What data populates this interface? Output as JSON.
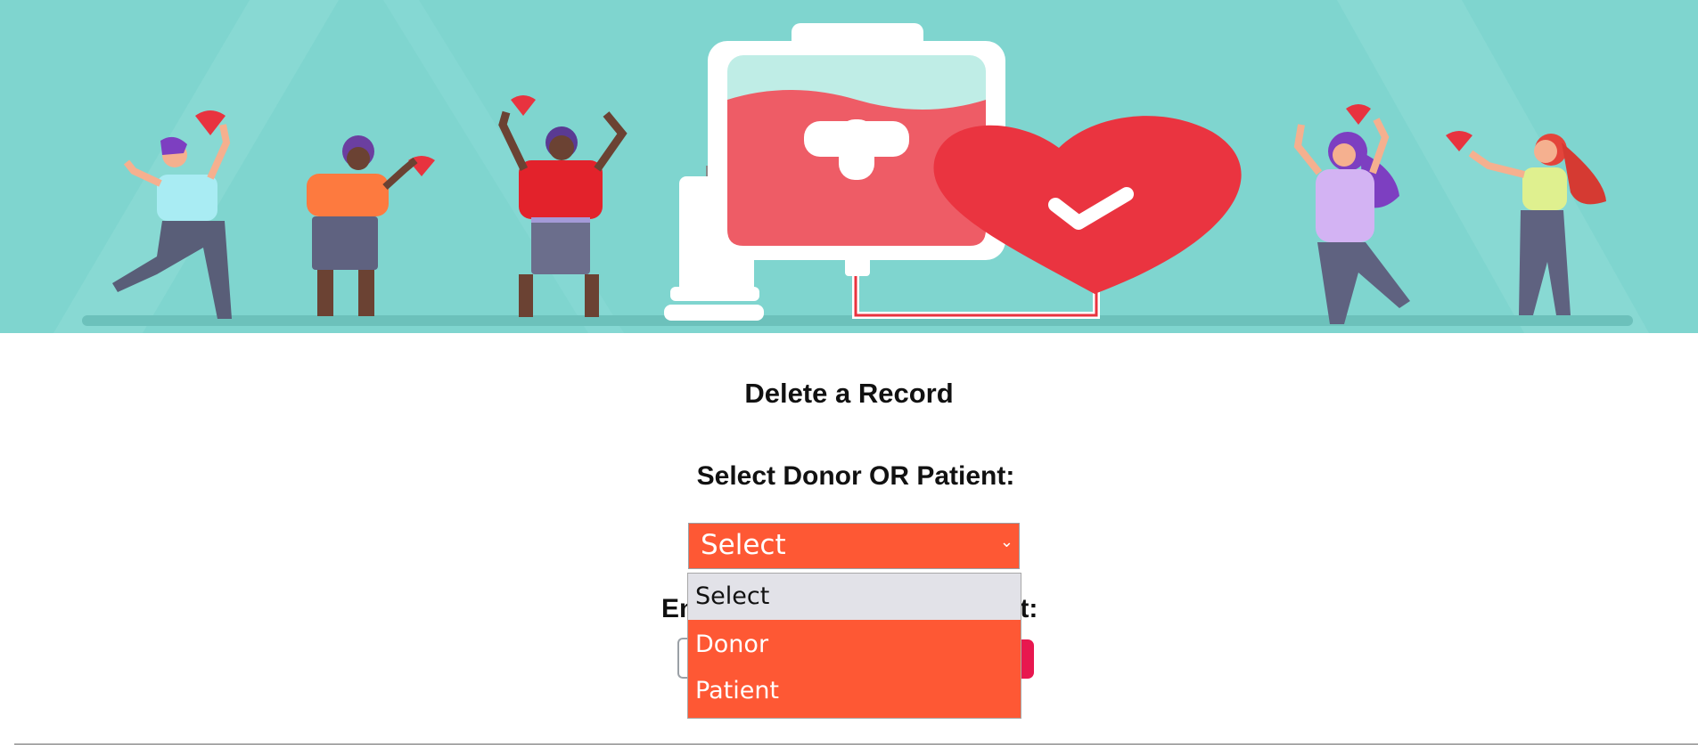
{
  "page": {
    "title": "Delete a Record",
    "select_label": "Select Donor OR Patient:",
    "second_label_start": "En",
    "second_label_end": "nt:"
  },
  "select": {
    "value": "Select",
    "options": [
      "Select",
      "Donor",
      "Patient"
    ]
  },
  "colors": {
    "accent": "#fe5834",
    "banner_bg": "#7fd5cf",
    "button_pink": "#e8174f"
  }
}
